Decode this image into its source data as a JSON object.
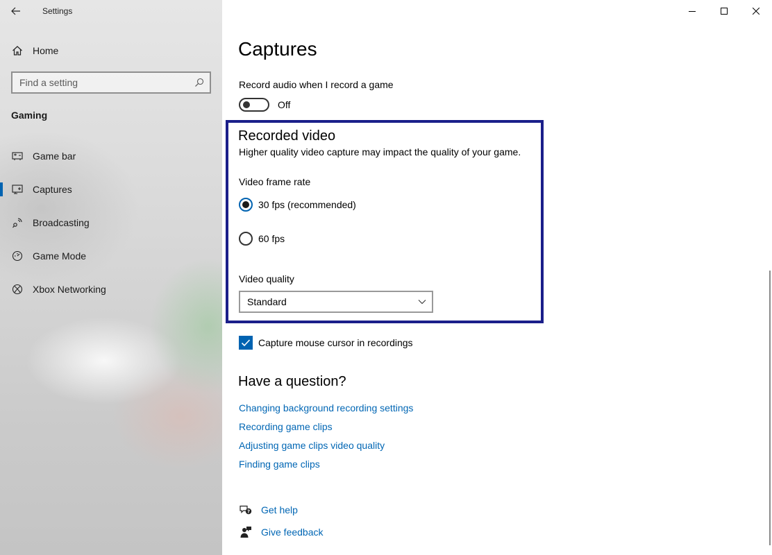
{
  "window": {
    "app_title": "Settings"
  },
  "sidebar": {
    "home_label": "Home",
    "search_placeholder": "Find a setting",
    "section_title": "Gaming",
    "items": [
      {
        "label": "Game bar",
        "icon": "game-bar-icon",
        "active": false
      },
      {
        "label": "Captures",
        "icon": "captures-icon",
        "active": true
      },
      {
        "label": "Broadcasting",
        "icon": "broadcasting-icon",
        "active": false
      },
      {
        "label": "Game Mode",
        "icon": "game-mode-icon",
        "active": false
      },
      {
        "label": "Xbox Networking",
        "icon": "xbox-icon",
        "active": false
      }
    ]
  },
  "main": {
    "page_title": "Captures",
    "record_audio": {
      "label": "Record audio when I record a game",
      "state": "Off"
    },
    "recorded_video": {
      "heading": "Recorded video",
      "description": "Higher quality video capture may impact the quality of your game.",
      "frame_rate_label": "Video frame rate",
      "options": [
        "30 fps (recommended)",
        "60 fps"
      ],
      "selected_option": "30 fps (recommended)",
      "quality_label": "Video quality",
      "quality_value": "Standard"
    },
    "capture_cursor": {
      "label": "Capture mouse cursor in recordings",
      "checked": true
    },
    "question": {
      "heading": "Have a question?",
      "links": [
        "Changing background recording settings",
        "Recording game clips",
        "Adjusting game clips video quality",
        "Finding game clips"
      ]
    },
    "get_help": "Get help",
    "give_feedback": "Give feedback"
  },
  "colors": {
    "accent": "#0063b1",
    "link": "#0066b4",
    "highlight_border": "#1b1f8a"
  }
}
